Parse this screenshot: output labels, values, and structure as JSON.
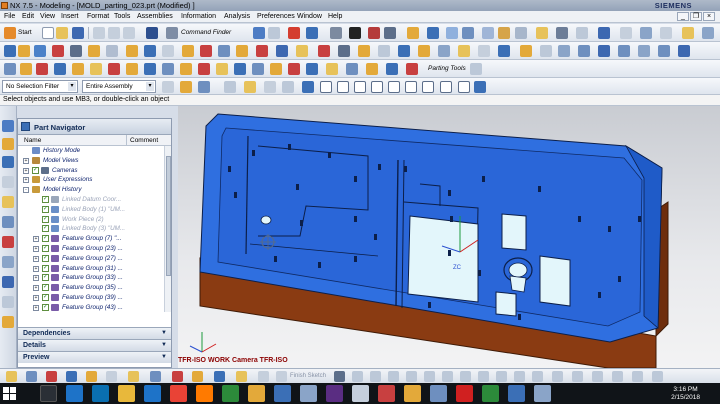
{
  "window": {
    "title": "NX 7.5 - Modeling - [MOLD_parting_023.prt (Modified) ]",
    "brand": "SIEMENS"
  },
  "menu": [
    "File",
    "Edit",
    "View",
    "Insert",
    "Format",
    "Tools",
    "Assemblies",
    "Information",
    "Analysis",
    "Preferences",
    "Window",
    "Help"
  ],
  "toolbar": {
    "start_label": "Start",
    "command_finder_label": "Command Finder",
    "parting_tools_label": "Parting Tools",
    "selection_filter": "No Selection Filter",
    "assembly_scope": "Entire Assembly"
  },
  "cue_line": "Select objects and use MB3, or double-click an object",
  "part_navigator": {
    "title": "Part Navigator",
    "columns": {
      "name": "Name",
      "comment": "Comment"
    },
    "tree": [
      {
        "label": "History Mode",
        "indent": 0,
        "expand": "",
        "check": false,
        "icon": "#6b8cc7",
        "dim": false
      },
      {
        "label": "Model Views",
        "indent": 0,
        "expand": "+",
        "check": false,
        "icon": "#b7893c",
        "dim": false
      },
      {
        "label": "Cameras",
        "indent": 0,
        "expand": "+",
        "check": true,
        "icon": "#5c6e8a",
        "dim": false
      },
      {
        "label": "User Expressions",
        "indent": 0,
        "expand": "+",
        "check": false,
        "icon": "#c89a3a",
        "dim": false
      },
      {
        "label": "Model History",
        "indent": 0,
        "expand": "-",
        "check": false,
        "icon": "#c89a3a",
        "dim": false
      },
      {
        "label": "Linked Datum Coor...",
        "indent": 1,
        "expand": "",
        "check": true,
        "icon": "#9aa7ba",
        "dim": true
      },
      {
        "label": "Linked Body (1) \"UM...",
        "indent": 1,
        "expand": "",
        "check": true,
        "icon": "#6a8fc8",
        "dim": true
      },
      {
        "label": "Work Piece (2)",
        "indent": 1,
        "expand": "",
        "check": true,
        "icon": "#6a8fc8",
        "dim": true
      },
      {
        "label": "Linked Body (3) \"UM...",
        "indent": 1,
        "expand": "",
        "check": true,
        "icon": "#6a8fc8",
        "dim": true
      },
      {
        "label": "Feature Group (7) \"...",
        "indent": 1,
        "expand": "+",
        "check": true,
        "icon": "#7a5ca8",
        "dim": false
      },
      {
        "label": "Feature Group (23) ...",
        "indent": 1,
        "expand": "+",
        "check": true,
        "icon": "#7a5ca8",
        "dim": false
      },
      {
        "label": "Feature Group (27) ...",
        "indent": 1,
        "expand": "+",
        "check": true,
        "icon": "#7a5ca8",
        "dim": false
      },
      {
        "label": "Feature Group (31) ...",
        "indent": 1,
        "expand": "+",
        "check": true,
        "icon": "#7a5ca8",
        "dim": false
      },
      {
        "label": "Feature Group (33) ...",
        "indent": 1,
        "expand": "+",
        "check": true,
        "icon": "#7a5ca8",
        "dim": false
      },
      {
        "label": "Feature Group (35) ...",
        "indent": 1,
        "expand": "+",
        "check": true,
        "icon": "#7a5ca8",
        "dim": false
      },
      {
        "label": "Feature Group (39) ...",
        "indent": 1,
        "expand": "+",
        "check": true,
        "icon": "#7a5ca8",
        "dim": false
      },
      {
        "label": "Feature Group (43) ...",
        "indent": 1,
        "expand": "+",
        "check": true,
        "icon": "#7a5ca8",
        "dim": false
      }
    ],
    "panels": [
      "Dependencies",
      "Details",
      "Preview"
    ]
  },
  "viewport": {
    "caption": "TFR-ISO WORK Camera TFR-ISO",
    "axis_label": "ZC"
  },
  "bottom_toolbar": {
    "finish_sketch_label": "Finish Sketch"
  },
  "taskbar": {
    "time": "3:16 PM",
    "date": "2/15/2018"
  },
  "colors": {
    "part_blue": "#2f6fe0",
    "part_dark_blue": "#143a8a",
    "base_brown": "#8a3b12",
    "insert_cyan": "#e3f6fb"
  }
}
